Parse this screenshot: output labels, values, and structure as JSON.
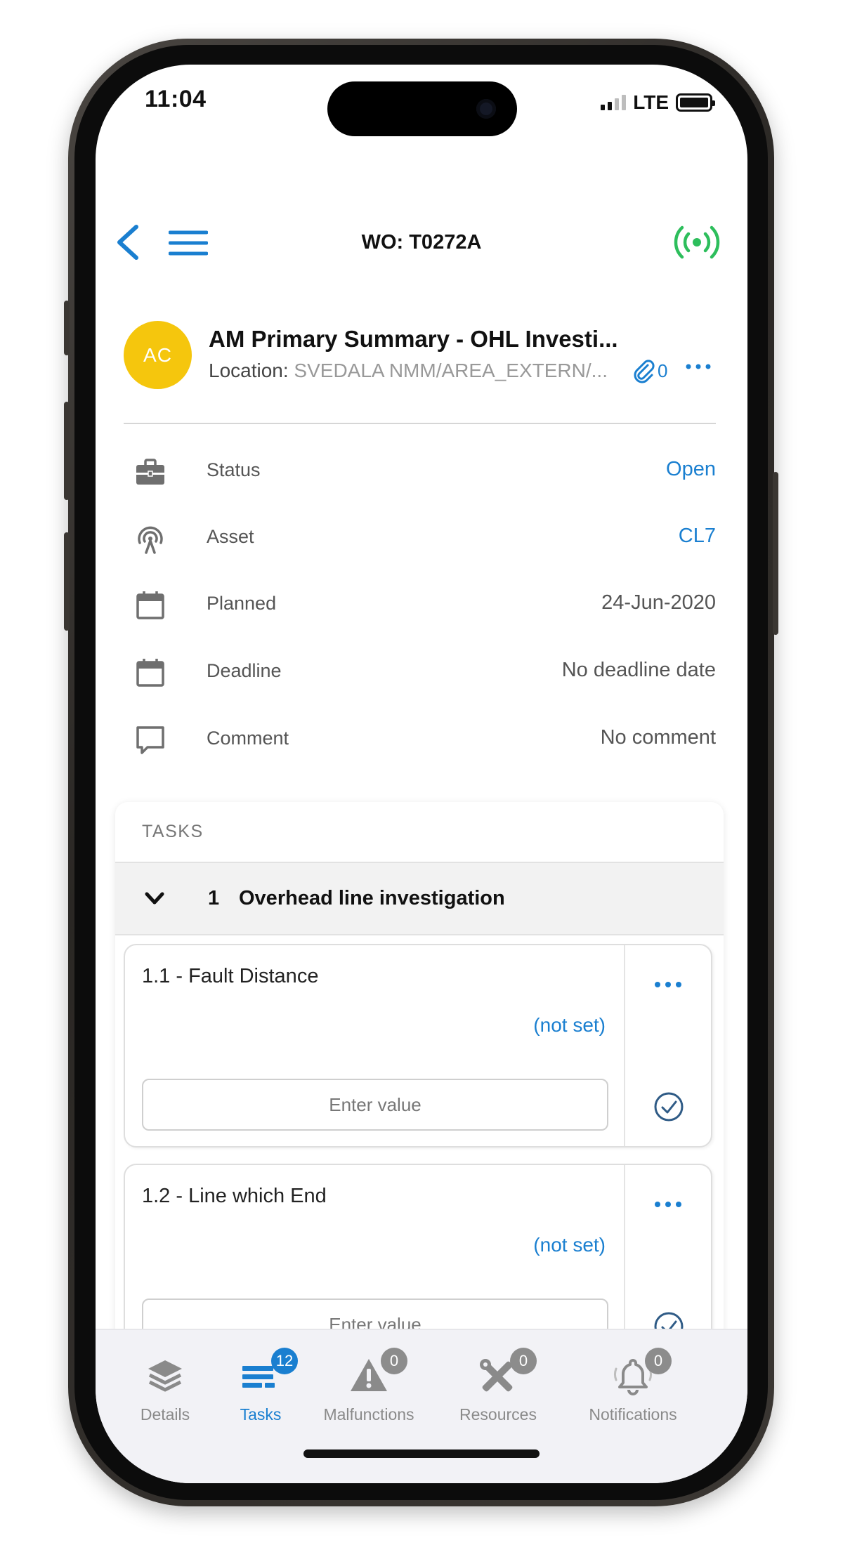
{
  "status_bar": {
    "time": "11:04",
    "network": "LTE"
  },
  "topbar": {
    "title": "WO: T0272A",
    "back_icon": "chevron-left-icon",
    "menu_icon": "hamburger-icon",
    "sync_icon": "wireless-signal-icon"
  },
  "header": {
    "avatar_initials": "AC",
    "avatar_color": "#F5C60D",
    "title": "AM Primary Summary - OHL Investi...",
    "location_label": "Location:",
    "location_value": "SVEDALA NMM/AREA_EXTERN/...",
    "attachment_count": "0"
  },
  "info": {
    "status": {
      "label": "Status",
      "value": "Open"
    },
    "asset": {
      "label": "Asset",
      "value": "CL7"
    },
    "planned": {
      "label": "Planned",
      "value": "24-Jun-2020"
    },
    "deadline": {
      "label": "Deadline",
      "value": "No deadline date"
    },
    "comment": {
      "label": "Comment",
      "value": "No comment"
    }
  },
  "tasks": {
    "section_title": "TASKS",
    "group": {
      "number": "1",
      "name": "Overhead line investigation"
    },
    "items": [
      {
        "title": "1.1 - Fault Distance",
        "status": "(not set)",
        "placeholder": "Enter value"
      },
      {
        "title": "1.2 - Line which End",
        "status": "(not set)",
        "placeholder": "Enter value"
      }
    ]
  },
  "bottom_nav": [
    {
      "label": "Details",
      "icon": "layers-icon",
      "badge": ""
    },
    {
      "label": "Tasks",
      "icon": "tasks-list-icon",
      "badge": "12"
    },
    {
      "label": "Malfunctions",
      "icon": "warning-icon",
      "badge": "0"
    },
    {
      "label": "Resources",
      "icon": "tools-icon",
      "badge": "0"
    },
    {
      "label": "Notifications",
      "icon": "bell-icon",
      "badge": "0"
    }
  ],
  "colors": {
    "accent": "#1A7FD0",
    "online": "#2DBE5C",
    "avatar": "#F5C60D"
  }
}
